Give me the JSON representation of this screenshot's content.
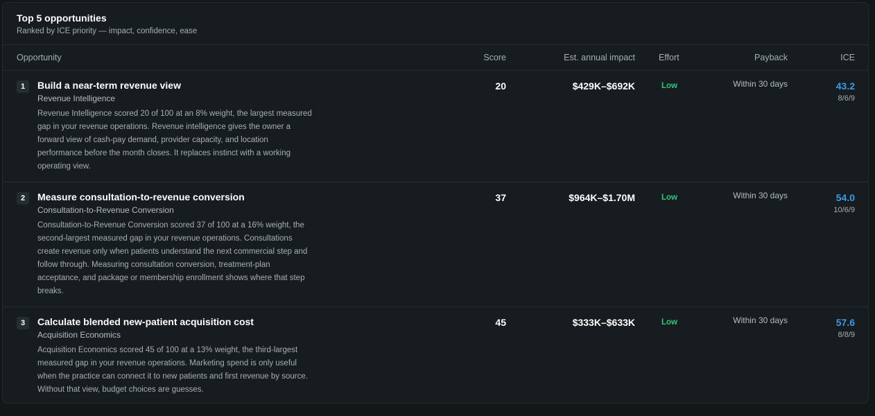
{
  "header": {
    "title": "Top 5 opportunities",
    "subtitle": "Ranked by ICE priority — impact, confidence, ease"
  },
  "columns": {
    "opportunity": "Opportunity",
    "score": "Score",
    "impact": "Est. annual impact",
    "effort": "Effort",
    "payback": "Payback",
    "ice": "ICE"
  },
  "rows": [
    {
      "rank": "1",
      "title": "Build a near-term revenue view",
      "category": "Revenue Intelligence",
      "description": "Revenue Intelligence scored 20 of 100 at an 8% weight, the largest measured gap in your revenue operations. Revenue intelligence gives the owner a forward view of cash-pay demand, provider capacity, and location performance before the month closes. It replaces instinct with a working operating view.",
      "score": "20",
      "impact": "$429K–$692K",
      "effort": "Low",
      "payback": "Within 30 days",
      "ice": "43.2",
      "ice_parts": "8/6/9"
    },
    {
      "rank": "2",
      "title": "Measure consultation-to-revenue conversion",
      "category": "Consultation-to-Revenue Conversion",
      "description": "Consultation-to-Revenue Conversion scored 37 of 100 at a 16% weight, the second-largest measured gap in your revenue operations. Consultations create revenue only when patients understand the next commercial step and follow through. Measuring consultation conversion, treatment-plan acceptance, and package or membership enrollment shows where that step breaks.",
      "score": "37",
      "impact": "$964K–$1.70M",
      "effort": "Low",
      "payback": "Within 30 days",
      "ice": "54.0",
      "ice_parts": "10/6/9"
    },
    {
      "rank": "3",
      "title": "Calculate blended new-patient acquisition cost",
      "category": "Acquisition Economics",
      "description": "Acquisition Economics scored 45 of 100 at a 13% weight, the third-largest measured gap in your revenue operations. Marketing spend is only useful when the practice can connect it to new patients and first revenue by source. Without that view, budget choices are guesses.",
      "score": "45",
      "impact": "$333K–$633K",
      "effort": "Low",
      "payback": "Within 30 days",
      "ice": "57.6",
      "ice_parts": "8/8/9"
    }
  ],
  "colors": {
    "background": "#121718",
    "panel": "#161c1f",
    "border": "#262d30",
    "effort_low": "#34c77b",
    "ice_accent": "#3d9be9"
  }
}
